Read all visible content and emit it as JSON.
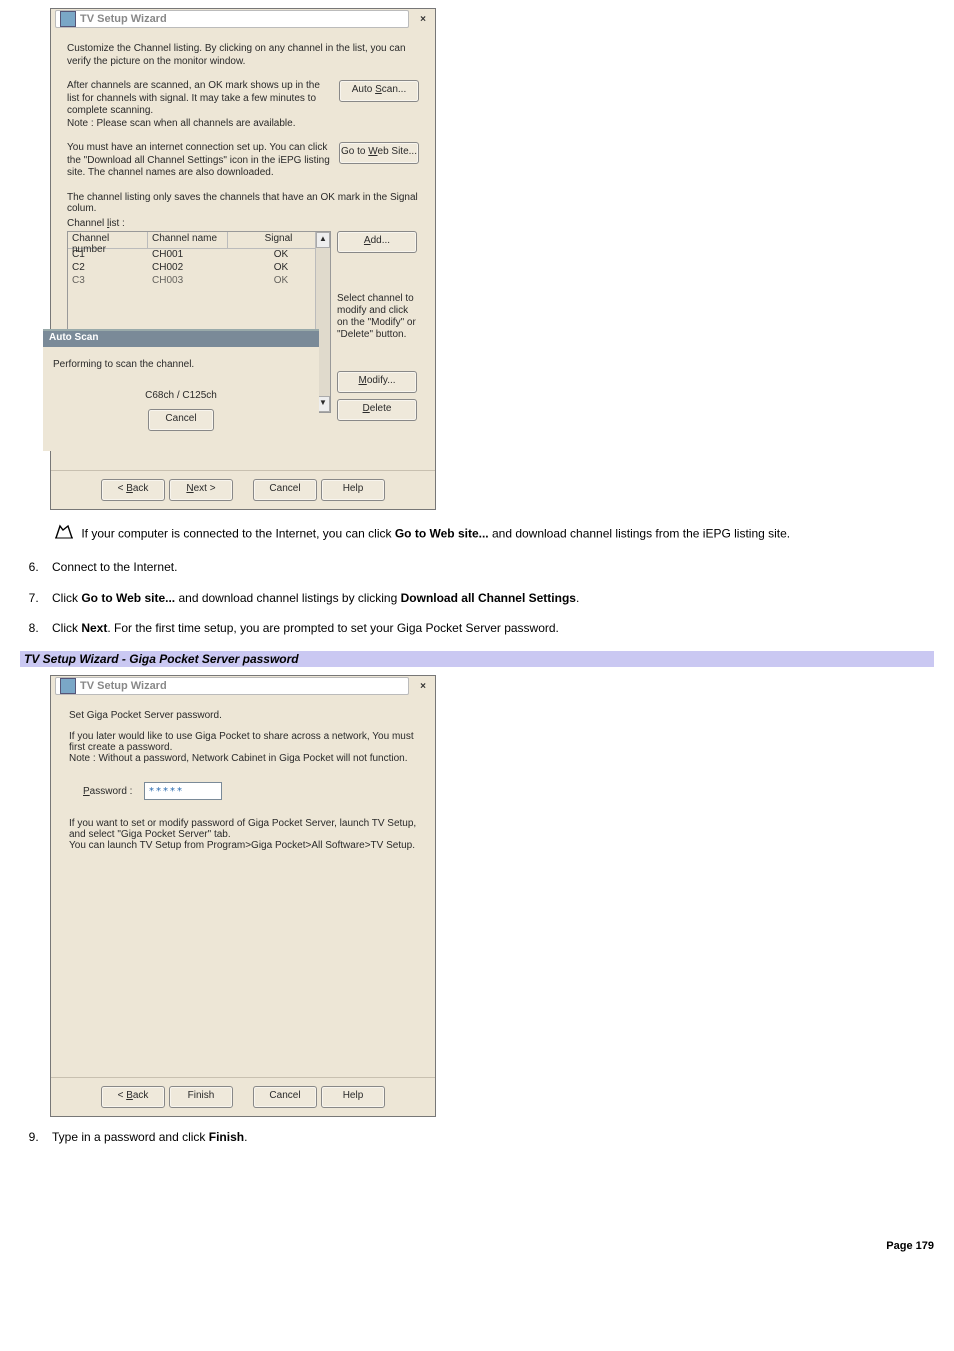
{
  "dialog1": {
    "title": "TV Setup Wizard",
    "intro": "Customize the Channel listing. By clicking on any channel in the list, you can verify the picture on the monitor window.",
    "scan_text": "After channels are scanned, an OK mark shows up in the list for channels with signal. It may take a few minutes to complete scanning.\nNote : Please scan when all channels are available.",
    "scan_button": "Auto Scan...",
    "scan_button_u": "S",
    "web_text": "You must have an internet connection set up. You can click the \"Download all Channel Settings\" icon in the iEPG listing site. The channel names are also downloaded.",
    "web_button": "Go to Web Site...",
    "web_button_u": "W",
    "listnote": "The channel listing only saves the channels that have an OK mark in the Signal colum.",
    "listlabel": "Channel list :",
    "listlabel_u": "l",
    "headers": {
      "num": "Channel number",
      "name": "Channel name",
      "sig": "Signal"
    },
    "rows": [
      {
        "num": "C1",
        "name": "CH001",
        "sig": "OK"
      },
      {
        "num": "C2",
        "name": "CH002",
        "sig": "OK"
      },
      {
        "num": "C3",
        "name": "CH003",
        "sig": "OK"
      }
    ],
    "add_button": "Add...",
    "add_button_u": "A",
    "side_hint": "Select channel to modify and click on the \"Modify\" or \"Delete\" button.",
    "modify_button": "Modify...",
    "modify_button_u": "M",
    "delete_button": "Delete",
    "delete_button_u": "D",
    "autoscan": {
      "title": "Auto Scan",
      "msg": "Performing to scan the channel.",
      "ch": "C68ch / C125ch",
      "cancel": "Cancel"
    },
    "nav": {
      "back": "< Back",
      "back_u": "B",
      "next": "Next >",
      "next_u": "N",
      "cancel": "Cancel",
      "help": "Help"
    }
  },
  "note": {
    "text_before": "If your computer is connected to the Internet, you can click ",
    "go_to_web": "Go to Web site...",
    "text_after": " and download channel listings from the iEPG listing site."
  },
  "steps": {
    "s6": "Connect to the Internet.",
    "s7_a": "Click ",
    "s7_b": "Go to Web site...",
    "s7_c": " and download channel listings by clicking ",
    "s7_d": "Download all Channel Settings",
    "s7_e": ".",
    "s8_a": "Click ",
    "s8_b": "Next",
    "s8_c": ". For the first time setup, you are prompted to set your Giga Pocket Server password."
  },
  "caption2": "TV Setup Wizard - Giga Pocket Server password",
  "dialog2": {
    "title": "TV Setup Wizard",
    "line1": "Set Giga Pocket Server password.",
    "line2": "If you later would like to use Giga Pocket to share across a network, You must first create a password.\nNote : Without a password, Network Cabinet in Giga Pocket will not function.",
    "pw_label": "Password :",
    "pw_label_u": "P",
    "pw_value": "*****",
    "line3": "If you want to set or modify password of Giga Pocket Server, launch TV Setup, and select \"Giga Pocket Server\" tab.\nYou can launch TV Setup from Program>Giga Pocket>All Software>TV Setup.",
    "nav": {
      "back": "< Back",
      "back_u": "B",
      "finish": "Finish",
      "cancel": "Cancel",
      "help": "Help"
    }
  },
  "step9_a": "Type in a password and click ",
  "step9_b": "Finish",
  "step9_c": ".",
  "page_number": "Page 179"
}
